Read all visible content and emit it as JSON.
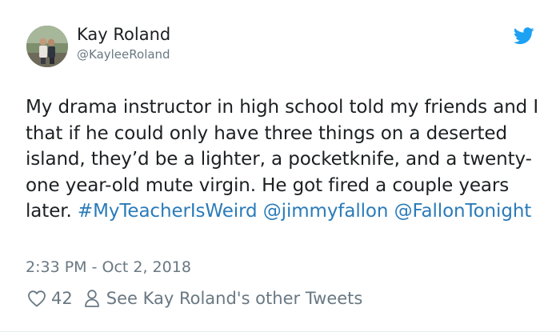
{
  "user": {
    "name": "Kay Roland",
    "handle": "@KayleeRoland"
  },
  "tweet": {
    "text": "My drama instructor in high school told my friends and I that if he could only have three things on a deserted island, they’d be a lighter, a pocketknife, and a twenty-one year-old mute virgin. He got fired a couple years later. ",
    "hashtag": "#MyTeacherIsWeird",
    "mention1": "@jimmyfallon",
    "mention2": "@FallonTonight",
    "timestamp": "2:33 PM - Oct 2, 2018"
  },
  "actions": {
    "likes": "42",
    "other_tweets": "See Kay Roland's other Tweets"
  },
  "colors": {
    "link": "#2b7bb9",
    "twitter_blue": "#1da1f2",
    "muted": "#697882",
    "text": "#1c2022"
  },
  "icons": {
    "bird": "twitter-bird-icon",
    "heart": "heart-icon",
    "person": "person-icon"
  }
}
